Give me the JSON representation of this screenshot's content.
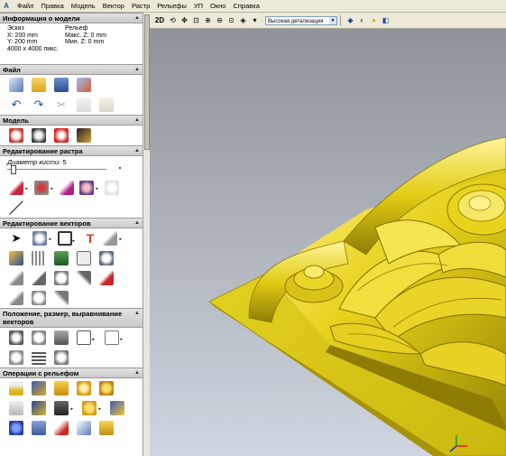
{
  "menu": {
    "items": [
      "Файл",
      "Правка",
      "Модель",
      "Вектор",
      "Растр",
      "Рельефы",
      "УП",
      "Окно",
      "Справка"
    ]
  },
  "panel": {
    "model_info": {
      "title": "Информация о модели",
      "sketch_label": "Эскиз",
      "relief_label": "Рельеф",
      "x_size": "X: 200 mm",
      "y_size": "Y: 200 mm",
      "max_z": "Макс. Z: 0 mm",
      "min_z": "Мин. Z: 0 mm",
      "resolution": "4000 x 4000 пикс."
    },
    "file_title": "Файл",
    "model_title": "Модель",
    "raster_title": "Редактирование растра",
    "brush_label": "Диаметр кисти:",
    "brush_value": "5",
    "vector_title": "Редактирование векторов",
    "position_title": "Положение, размер, выравнивание векторов",
    "relief_ops_title": "Операции с рельефом",
    "collapse_glyph": "▲"
  },
  "toolbar": {
    "mode_2d": "2D",
    "detail_value": "Высокая детализация"
  },
  "colors": {
    "relief": "#e6d21a",
    "relief_shadow": "#9c8a05",
    "viewport_bg_top": "#8f939a",
    "viewport_bg_bottom": "#cfd6df"
  },
  "icons": {
    "file_row1": [
      "new-model-icon",
      "open-icon",
      "save-icon",
      "import-icon"
    ],
    "file_row2": [
      "undo-icon",
      "redo-icon",
      "cut-icon",
      "copy-icon",
      "paste-icon"
    ],
    "model_row": [
      "model-settings-icon",
      "image-icon",
      "paint-icon",
      "bitmap-icon"
    ],
    "raster_row": [
      "pencil-icon",
      "fill-icon",
      "brush-color-icon",
      "shade-icon",
      "cloud-icon"
    ]
  }
}
